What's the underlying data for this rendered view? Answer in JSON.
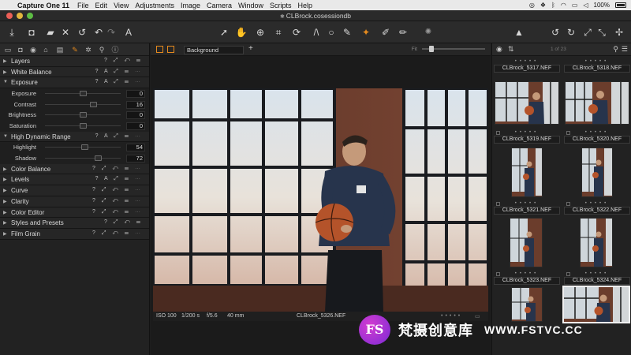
{
  "menubar": {
    "apple": "",
    "menus": [
      "Capture One 11",
      "File",
      "Edit",
      "View",
      "Adjustments",
      "Image",
      "Camera",
      "Window",
      "Scripts",
      "Help"
    ],
    "battery": "100%",
    "time": "5:05 PM"
  },
  "titlebar": {
    "title": "CLBrock.cosessiondb"
  },
  "left_panel": {
    "tools": [
      {
        "name": "Layers",
        "expanded": false
      },
      {
        "name": "White Balance",
        "expanded": false
      },
      {
        "name": "Exposure",
        "expanded": true
      },
      {
        "name": "High Dynamic Range",
        "expanded": true
      },
      {
        "name": "Color Balance",
        "expanded": false
      },
      {
        "name": "Levels",
        "expanded": false
      },
      {
        "name": "Curve",
        "expanded": false
      },
      {
        "name": "Clarity",
        "expanded": false
      },
      {
        "name": "Color Editor",
        "expanded": false
      },
      {
        "name": "Styles and Presets",
        "expanded": false
      },
      {
        "name": "Film Grain",
        "expanded": false
      }
    ],
    "exposure": [
      {
        "label": "Exposure",
        "value": "0",
        "pos": 0.5
      },
      {
        "label": "Contrast",
        "value": "16",
        "pos": 0.62
      },
      {
        "label": "Brightness",
        "value": "0",
        "pos": 0.5
      },
      {
        "label": "Saturation",
        "value": "0",
        "pos": 0.5
      }
    ],
    "hdr": [
      {
        "label": "Highlight",
        "value": "54",
        "pos": 0.52
      },
      {
        "label": "Shadow",
        "value": "72",
        "pos": 0.7
      }
    ],
    "tool_controls": "? A ⇆ ☰ ⋯"
  },
  "viewer": {
    "layer_select": "Background",
    "fit_label": "Fit",
    "meta": {
      "iso": "ISO 100",
      "shutter": "1/200 s",
      "aperture": "f/5.6",
      "focal": "40 mm",
      "filename": "CLBrock_5326.NEF"
    }
  },
  "browser": {
    "count": "1 of 23",
    "items": [
      {
        "name": "CLBrock_5317.NEF"
      },
      {
        "name": "CLBrock_5318.NEF"
      },
      {
        "name": "CLBrock_5319.NEF"
      },
      {
        "name": "CLBrock_5320.NEF"
      },
      {
        "name": "CLBrock_5321.NEF"
      },
      {
        "name": "CLBrock_5322.NEF"
      },
      {
        "name": "CLBrock_5323.NEF"
      },
      {
        "name": "CLBrock_5324.NEF"
      }
    ]
  },
  "watermark": {
    "logo": "FS",
    "text": "梵摄创意库",
    "url": "WWW.FSTVC.CC"
  },
  "colors": {
    "accent": "#e58a1e",
    "panel": "#222222",
    "viewer_bg": "#1b1b1b"
  }
}
